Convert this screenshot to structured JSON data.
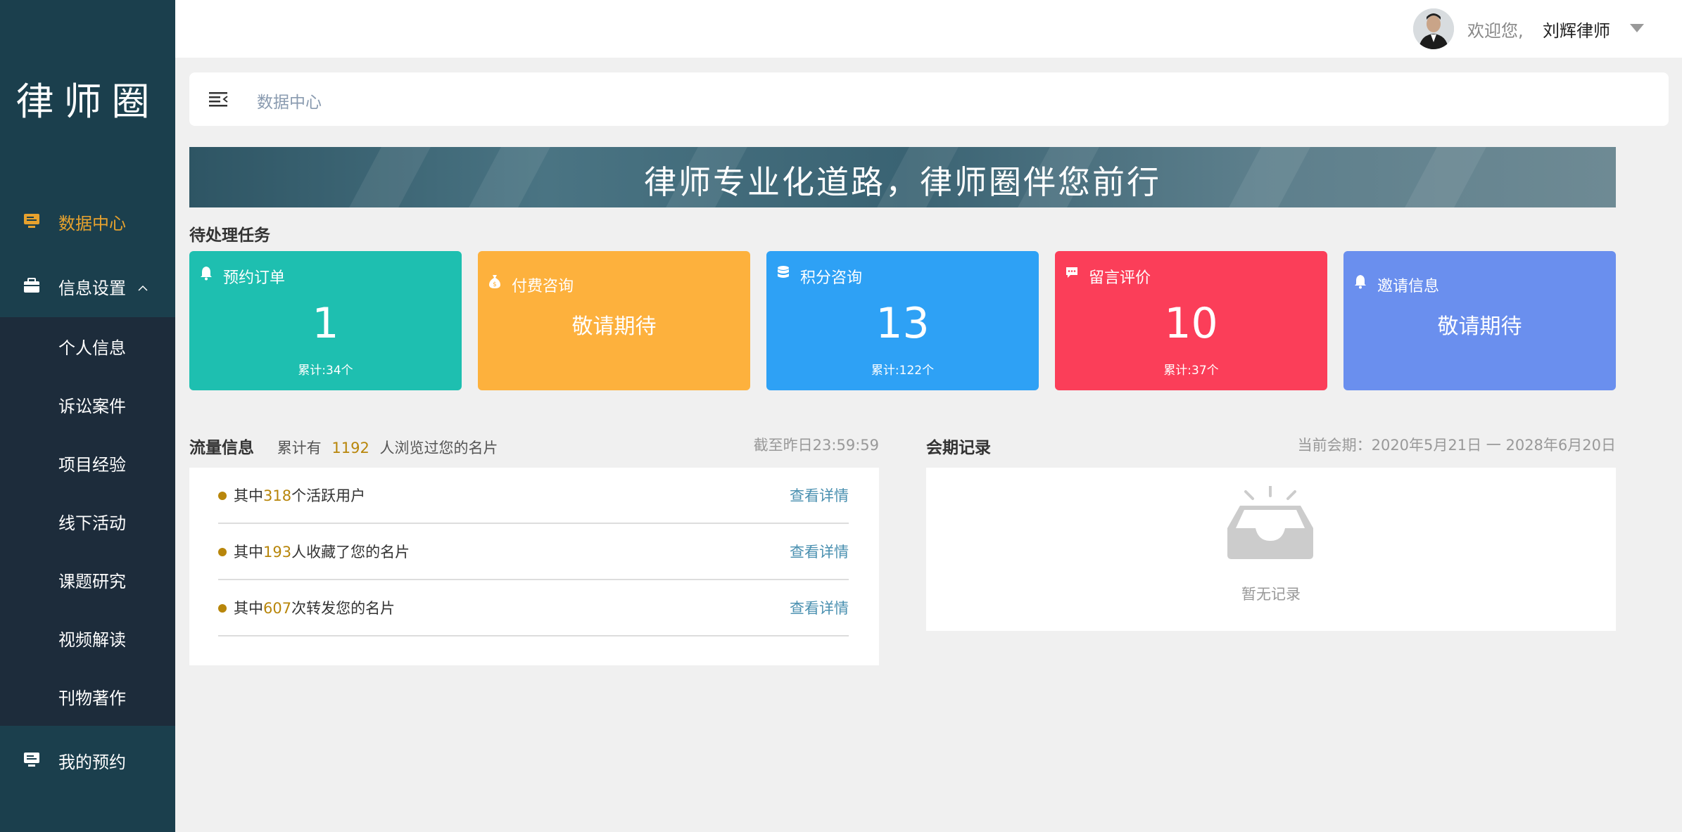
{
  "sidebar": {
    "brand": "律师圈",
    "nav": [
      {
        "label": "数据中心",
        "active": true
      },
      {
        "label": "信息设置",
        "active": false
      },
      {
        "label": "我的预约",
        "active": false
      }
    ],
    "submenu": [
      "个人信息",
      "诉讼案件",
      "项目经验",
      "线下活动",
      "课题研究",
      "视频解读",
      "刊物著作"
    ]
  },
  "header": {
    "welcome": "欢迎您,",
    "username": "刘辉律师"
  },
  "breadcrumb": "数据中心",
  "banner": "律师专业化道路，律师圈伴您前行",
  "tasks": {
    "title": "待处理任务",
    "cards": [
      {
        "title": "预约订单",
        "count": "1",
        "total": "累计:34个",
        "color": "#1ebfb0"
      },
      {
        "title": "付费咨询",
        "soon": "敬请期待",
        "color": "#fdb13d"
      },
      {
        "title": "积分咨询",
        "count": "13",
        "total": "累计:122个",
        "color": "#2ea1f5"
      },
      {
        "title": "留言评价",
        "count": "10",
        "total": "累计:37个",
        "color": "#fb3e59"
      },
      {
        "title": "邀请信息",
        "soon": "敬请期待",
        "color": "#6a8fee"
      }
    ]
  },
  "traffic": {
    "title": "流量信息",
    "summary_prefix": "累计有",
    "summary_count": "1192",
    "summary_suffix": "人浏览过您的名片",
    "as_of": "截至昨日23:59:59",
    "rows": [
      {
        "prefix": "其中",
        "num": "318",
        "suffix": "个活跃用户",
        "link": "查看详情"
      },
      {
        "prefix": "其中",
        "num": "193",
        "suffix": "人收藏了您的名片",
        "link": "查看详情"
      },
      {
        "prefix": "其中",
        "num": "607",
        "suffix": "次转发您的名片",
        "link": "查看详情"
      }
    ]
  },
  "membership": {
    "title": "会期记录",
    "period": "当前会期：2020年5月21日 一 2028年6月20日",
    "empty": "暂无记录"
  }
}
